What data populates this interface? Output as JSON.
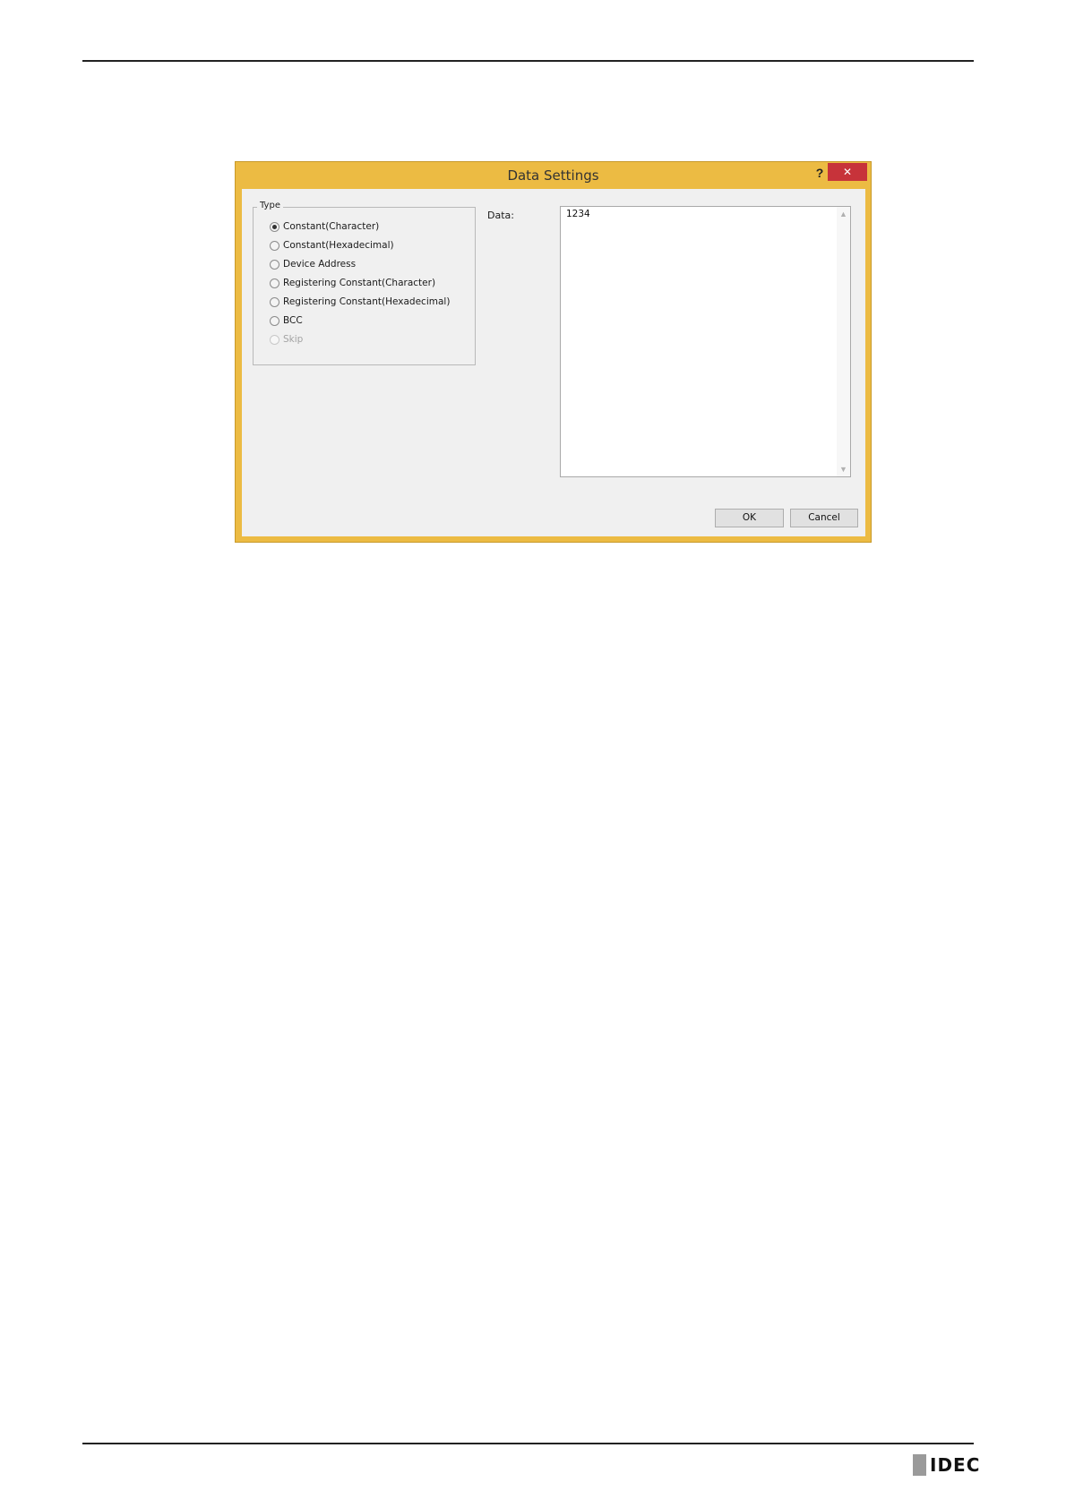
{
  "dialog": {
    "title": "Data Settings",
    "help_label": "?",
    "close_label": "✕"
  },
  "type_group": {
    "legend": "Type",
    "options": [
      {
        "label": "Constant(Character)",
        "checked": true,
        "enabled": true
      },
      {
        "label": "Constant(Hexadecimal)",
        "checked": false,
        "enabled": true
      },
      {
        "label": "Device Address",
        "checked": false,
        "enabled": true
      },
      {
        "label": "Registering Constant(Character)",
        "checked": false,
        "enabled": true
      },
      {
        "label": "Registering Constant(Hexadecimal)",
        "checked": false,
        "enabled": true
      },
      {
        "label": "BCC",
        "checked": false,
        "enabled": true
      },
      {
        "label": "Skip",
        "checked": false,
        "enabled": false
      }
    ]
  },
  "data_field": {
    "label": "Data:",
    "value": "1234"
  },
  "buttons": {
    "ok_label": "OK",
    "cancel_label": "Cancel"
  },
  "footer": {
    "logo_text": "IDEC"
  },
  "colors": {
    "dialog_frame": "#ecbb43",
    "close_button": "#c7333a"
  }
}
